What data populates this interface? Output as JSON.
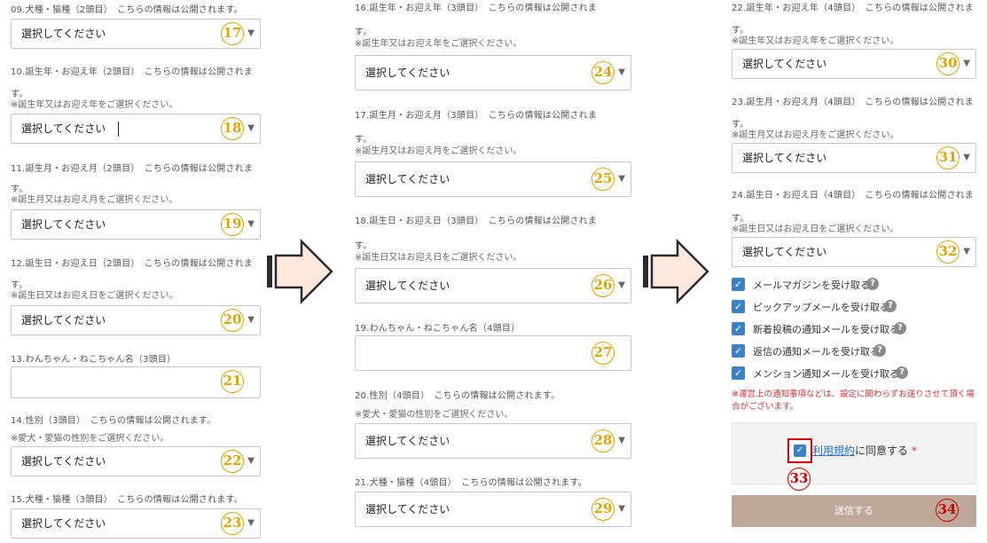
{
  "select_placeholder": "選択してください",
  "col1": {
    "f09_label": "09.犬種・猫種（2頭目）　こちらの情報は公開されます。",
    "f10_label": "10.誕生年・お迎え年（2頭目）　こちらの情報は公開されま",
    "f10_wrap": "す。",
    "f10_note": "※誕生年又はお迎え年をご選択ください。",
    "f11_label": "11.誕生月・お迎え月（2頭目）　こちらの情報は公開されま",
    "f11_wrap": "す。",
    "f11_note": "※誕生月又はお迎え月をご選択ください。",
    "f12_label": "12.誕生日・お迎え日（2頭目）　こちらの情報は公開されま",
    "f12_wrap": "す。",
    "f12_note": "※誕生日又はお迎え日をご選択ください。",
    "f13_label": "13.わんちゃん・ねこちゃん名（3頭目）",
    "f14_label": "14.性別（3頭目）　こちらの情報は公開されます。",
    "f14_note": "※愛犬・愛猫の性別をご選択ください。",
    "f15_label": "15.犬種・猫種（3頭目）　こちらの情報は公開されます。"
  },
  "col2": {
    "f16_label": "16.誕生年・お迎え年（3頭目）　こちらの情報は公開されま",
    "f16_wrap": "す。",
    "f16_note": "※誕生年又はお迎え年をご選択ください。",
    "f17_label": "17.誕生月・お迎え月（3頭目）　こちらの情報は公開されま",
    "f17_wrap": "す。",
    "f17_note": "※誕生月又はお迎え月をご選択ください。",
    "f18_label": "18.誕生日・お迎え日（3頭目）　こちらの情報は公開されま",
    "f18_wrap": "す。",
    "f18_note": "※誕生日又はお迎え日をご選択ください。",
    "f19_label": "19.わんちゃん・ねこちゃん名（4頭目）",
    "f20_label": "20.性別（4頭目）　こちらの情報は公開されます。",
    "f20_note": "※愛犬・愛猫の性別をご選択ください。",
    "f21_label": "21.犬種・猫種（4頭目）　こちらの情報は公開されます。"
  },
  "col3": {
    "f22_label": "22.誕生年・お迎え年（4頭目）　こちらの情報は公開されま",
    "f22_wrap": "す。",
    "f22_note": "※誕生年又はお迎え年をご選択ください。",
    "f23_label": "23.誕生月・お迎え月（4頭目）　こちらの情報は公開されま",
    "f23_wrap": "す。",
    "f23_note": "※誕生月又はお迎え月をご選択ください。",
    "f24_label": "24.誕生日・お迎え日（4頭目）　こちらの情報は公開されま",
    "f24_wrap": "す。",
    "f24_note": "※誕生日又はお迎え日をご選択ください。",
    "checkboxes": [
      "メールマガジンを受け取る",
      "ピックアップメールを受け取る",
      "新着投稿の通知メールを受け取る",
      "返信の通知メールを受け取る",
      "メンション通知メールを受け取る"
    ],
    "warning_line1": "※運営上の通知事項などは、設定に関わらずお送りさせて頂く場",
    "warning_line2": "合がございます。",
    "agree_link": "利用規約",
    "agree_text": "に同意する",
    "agree_required": "*",
    "submit_label": "送信する"
  },
  "badges": {
    "b17": "17",
    "b18": "18",
    "b19": "19",
    "b20": "20",
    "b21": "21",
    "b22": "22",
    "b23": "23",
    "b24": "24",
    "b25": "25",
    "b26": "26",
    "b27": "27",
    "b28": "28",
    "b29": "29",
    "b30": "30",
    "b31": "31",
    "b32": "32",
    "b33": "33",
    "b34": "34"
  },
  "icons": {
    "dropdown": "▼",
    "check": "✓",
    "help": "?"
  },
  "colors": {
    "badge_yellow": "#e0a400",
    "badge_red": "#cc0000",
    "checkbox_blue": "#3b82c4",
    "submit_bg": "#bfa89a",
    "warning_red": "#d93030",
    "arrow_fill": "#fde8dc"
  }
}
